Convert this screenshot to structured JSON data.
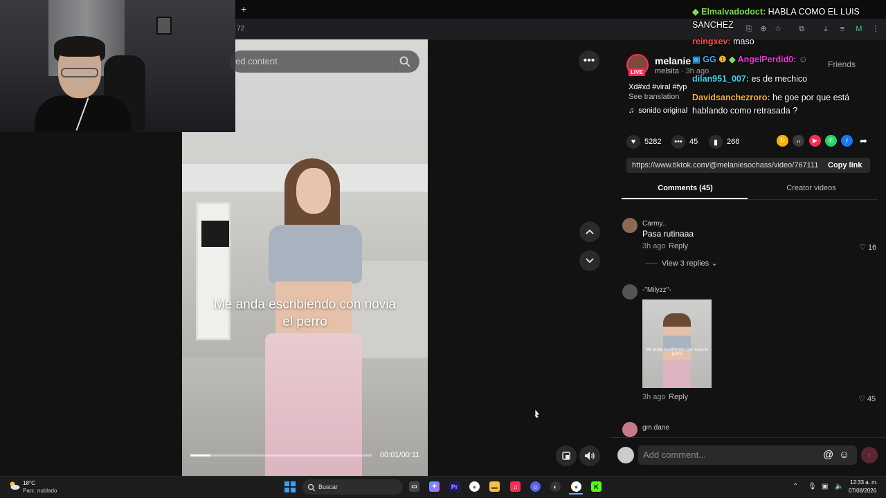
{
  "browser": {
    "new_tab": "+",
    "url_fragment": "72"
  },
  "search": {
    "placeholder_text": "ed content",
    "icon": "search-icon"
  },
  "video": {
    "caption": "Me anda escribiendo con novia el perro",
    "time": "00:01/00:11",
    "progress": 0.11,
    "more_icon": "more-dots-icon",
    "nav_up_icon": "chevron-up-icon",
    "nav_down_icon": "chevron-down-icon",
    "volume_icon": "volume-icon",
    "miniplayer_icon": "floating-player-icon"
  },
  "post": {
    "username": "melanie",
    "nickname": "melsita",
    "live_label": "LIVE",
    "time_ago": "· 3h ago",
    "friends_label": "Friends",
    "description": "Xd#xd #viral #fyp",
    "see_translation": "See translation",
    "sound_icon": "music-note-icon",
    "sound": "sonido original",
    "stats": {
      "likes": "5282",
      "comments": "45",
      "saves": "266"
    },
    "link": "https://www.tiktok.com/@melaniesochass/video/767111...",
    "copy_link": "Copy link"
  },
  "tabs": {
    "comments": "Comments (45)",
    "creator_videos": "Creator videos"
  },
  "comments": [
    {
      "name": "Carmy..",
      "text": "Pasa rutinaaa",
      "time": "3h ago",
      "reply": "Reply",
      "likes": "16",
      "view_replies": "View 3 replies"
    },
    {
      "name": "-\"Milyzz\"-",
      "thumb_caption": "Me anda escribiendo con novia el perro",
      "time": "3h ago",
      "reply": "Reply",
      "likes": "45"
    },
    {
      "name": "gm.dane"
    }
  ],
  "comment_input": {
    "placeholder": "Add comment...",
    "at_icon": "@",
    "emoji_icon": "☺",
    "send_icon": "↑"
  },
  "chat": [
    {
      "user": "Elmalvadodoct:",
      "msg": "HABLA COMO EL LUIS SANCHEZ",
      "color": "#7ee04a"
    },
    {
      "user": "reingxev:",
      "msg": "maso",
      "color": "#ff4b4b"
    },
    {
      "user": "AngelPerdid0:",
      "msg": "",
      "color": "#e83ad8"
    },
    {
      "user": "dilan951_007:",
      "msg": "es de mechico",
      "color": "#3fd6f0"
    },
    {
      "user": "Davidsanchezroro:",
      "msg": "he goe por que está hablando como retrasada ?",
      "color": "#f2b23a"
    }
  ],
  "taskbar": {
    "temp": "18°C",
    "weather": "Parc. nublado",
    "search": "Buscar",
    "time": "12:33 a. m.",
    "date": "07/08/2026"
  },
  "colors": {
    "accent": "#fe2c55",
    "background": "#121212"
  }
}
